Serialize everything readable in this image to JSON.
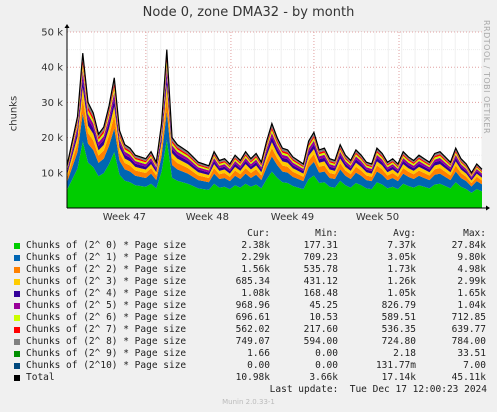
{
  "title": "Node 0, zone DMA32 - by month",
  "side_label": "RRDTOOL / TOBI OETIKER",
  "footer": "Munin 2.0.33-1",
  "last_update": "Last update:  Tue Dec 17 12:00:23 2024",
  "legend_headers": [
    "Cur:",
    "Min:",
    "Avg:",
    "Max:"
  ],
  "legend_rows": [
    {
      "name": "Chunks of (2^ 0) * Page size",
      "color": "#00cc00",
      "cur": "2.38k",
      "min": "177.31",
      "avg": "7.37k",
      "max": "27.84k"
    },
    {
      "name": "Chunks of (2^ 1) * Page size",
      "color": "#0066b3",
      "cur": "2.29k",
      "min": "709.23",
      "avg": "3.05k",
      "max": "9.80k"
    },
    {
      "name": "Chunks of (2^ 2) * Page size",
      "color": "#ff8000",
      "cur": "1.56k",
      "min": "535.78",
      "avg": "1.73k",
      "max": "4.98k"
    },
    {
      "name": "Chunks of (2^ 3) * Page size",
      "color": "#ffcc00",
      "cur": "685.34",
      "min": "431.12",
      "avg": "1.26k",
      "max": "2.99k"
    },
    {
      "name": "Chunks of (2^ 4) * Page size",
      "color": "#330099",
      "cur": "1.08k",
      "min": "168.48",
      "avg": "1.05k",
      "max": "1.65k"
    },
    {
      "name": "Chunks of (2^ 5) * Page size",
      "color": "#990099",
      "cur": "968.96",
      "min": "45.25",
      "avg": "826.79",
      "max": "1.04k"
    },
    {
      "name": "Chunks of (2^ 6) * Page size",
      "color": "#ccff00",
      "cur": "696.61",
      "min": "10.53",
      "avg": "589.51",
      "max": "712.85"
    },
    {
      "name": "Chunks of (2^ 7) * Page size",
      "color": "#ff0000",
      "cur": "562.02",
      "min": "217.60",
      "avg": "536.35",
      "max": "639.77"
    },
    {
      "name": "Chunks of (2^ 8) * Page size",
      "color": "#808080",
      "cur": "749.07",
      "min": "594.00",
      "avg": "724.80",
      "max": "784.00"
    },
    {
      "name": "Chunks of (2^ 9) * Page size",
      "color": "#008f00",
      "cur": "1.66",
      "min": "0.00",
      "avg": "2.18",
      "max": "33.51"
    },
    {
      "name": "Chunks of (2^10) * Page size",
      "color": "#00487d",
      "cur": "0.00",
      "min": "0.00",
      "avg": "131.77m",
      "max": "7.00"
    },
    {
      "name": "Total",
      "color": "#000000",
      "cur": "10.98k",
      "min": "3.66k",
      "avg": "17.14k",
      "max": "45.11k"
    }
  ],
  "chart_data": {
    "type": "area",
    "stacked": true,
    "ylabel": "chunks",
    "ylim": [
      0,
      50000
    ],
    "y_ticks": [
      10000,
      20000,
      30000,
      40000,
      50000
    ],
    "y_tick_labels": [
      "10 k",
      "20 k",
      "30 k",
      "40 k",
      "50 k"
    ],
    "x_tick_labels": [
      "Week 47",
      "Week 48",
      "Week 49",
      "Week 50"
    ],
    "grid": true,
    "series_order": [
      "2^ 0",
      "2^ 1",
      "2^ 2",
      "2^ 3",
      "2^ 4",
      "2^ 5",
      "2^ 6",
      "2^ 7",
      "2^ 8",
      "2^ 9",
      "2^10"
    ],
    "series_colors": [
      "#00cc00",
      "#0066b3",
      "#ff8000",
      "#ffcc00",
      "#330099",
      "#990099",
      "#ccff00",
      "#ff0000",
      "#808080",
      "#008f00",
      "#00487d"
    ],
    "total": [
      12000,
      19000,
      26000,
      44000,
      30000,
      27000,
      21000,
      23000,
      29000,
      37000,
      22000,
      18000,
      17000,
      15000,
      14500,
      14000,
      16000,
      13000,
      24000,
      45000,
      20000,
      18000,
      17000,
      16000,
      14500,
      13000,
      12500,
      12000,
      16000,
      13500,
      14000,
      12500,
      15000,
      13500,
      16000,
      14000,
      15500,
      13000,
      19000,
      24000,
      20000,
      17000,
      16500,
      14500,
      13500,
      12500,
      19000,
      21500,
      16500,
      17000,
      14000,
      13500,
      18000,
      15000,
      13500,
      16500,
      15000,
      13000,
      12500,
      17000,
      15500,
      13000,
      14000,
      12500,
      16000,
      14500,
      13500,
      15000,
      14000,
      13000,
      15500,
      16000,
      14500,
      13000,
      17000,
      14000,
      12500,
      10000,
      12500,
      11000
    ],
    "fractions": [
      0.43,
      0.18,
      0.1,
      0.07,
      0.06,
      0.05,
      0.035,
      0.03,
      0.04,
      0.003,
      0.002
    ]
  }
}
